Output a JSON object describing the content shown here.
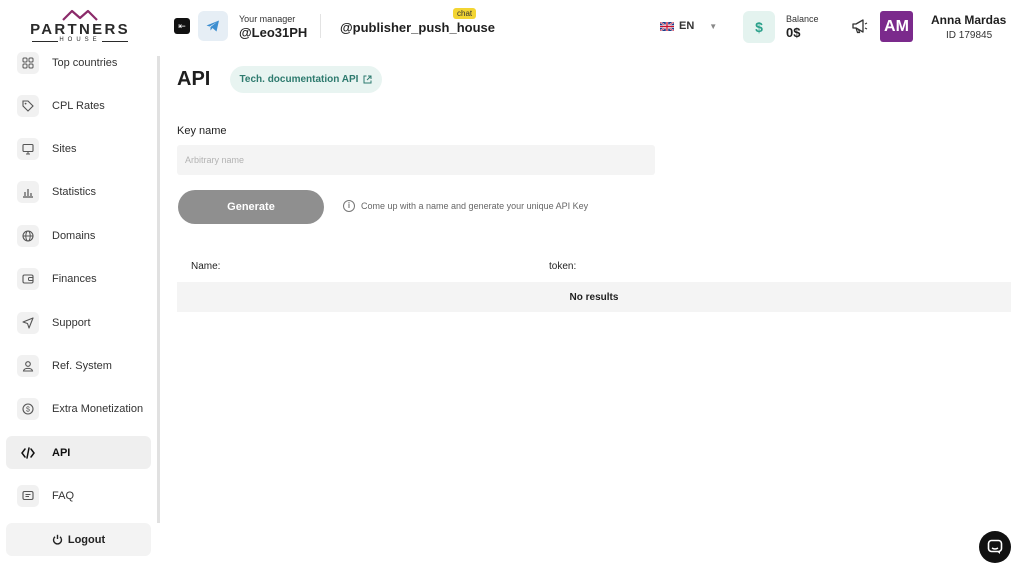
{
  "header": {
    "logo_text": "PARTNERS",
    "logo_sub": "HOUSE",
    "manager_label": "Your manager",
    "manager_name": "@Leo31PH",
    "channel": "@publisher_push_house",
    "chat_badge": "chat",
    "language": "EN",
    "balance_label": "Balance",
    "balance_value": "0$",
    "balance_icon": "$",
    "avatar_initials": "AM",
    "user_name": "Anna Mardas",
    "user_id": "ID 179845"
  },
  "sidebar": {
    "items": [
      {
        "label": "Top countries",
        "icon": "grid-icon"
      },
      {
        "label": "CPL Rates",
        "icon": "tag-icon"
      },
      {
        "label": "Sites",
        "icon": "monitor-icon"
      },
      {
        "label": "Statistics",
        "icon": "bar-chart-icon"
      },
      {
        "label": "Domains",
        "icon": "globe-icon"
      },
      {
        "label": "Finances",
        "icon": "wallet-icon"
      },
      {
        "label": "Support",
        "icon": "send-icon"
      },
      {
        "label": "Ref. System",
        "icon": "user-icon"
      },
      {
        "label": "Extra Monetization",
        "icon": "coin-icon"
      },
      {
        "label": "API",
        "icon": "code-icon",
        "active": true
      },
      {
        "label": "FAQ",
        "icon": "message-icon"
      }
    ],
    "logout_label": "Logout"
  },
  "main": {
    "title": "API",
    "doc_button": "Tech. documentation API",
    "key_label": "Key name",
    "key_placeholder": "Arbitrary name",
    "key_value": "",
    "generate_button": "Generate",
    "hint": "Come up with a name and generate your unique API Key",
    "table": {
      "columns": [
        "Name:",
        "token:"
      ],
      "empty_text": "No results"
    }
  },
  "colors": {
    "accent_teal": "#2d7a6e",
    "avatar_purple": "#7b2a8c",
    "chat_badge_yellow": "#f3d533",
    "generate_gray": "#8f8f8f"
  }
}
